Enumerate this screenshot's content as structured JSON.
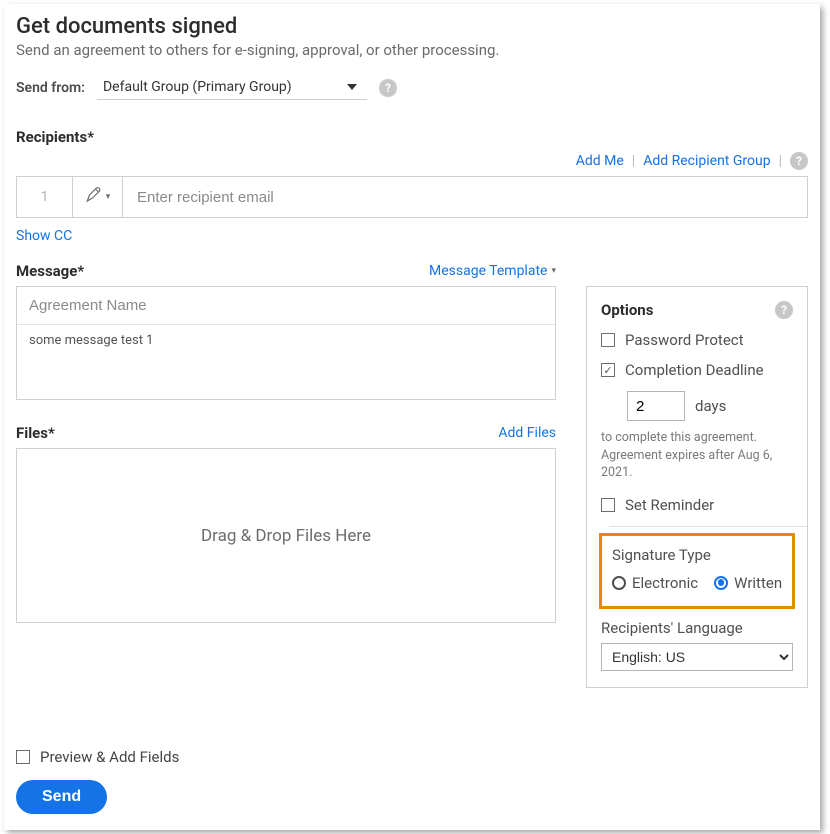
{
  "header": {
    "title": "Get documents signed",
    "subtitle": "Send an agreement to others for e-signing, approval, or other processing."
  },
  "send_from": {
    "label": "Send from:",
    "selected": "Default Group (Primary Group)"
  },
  "recipients": {
    "label": "Recipients*",
    "add_me": "Add Me",
    "add_group": "Add Recipient Group",
    "row_number": "1",
    "input_placeholder": "Enter recipient email",
    "show_cc": "Show CC"
  },
  "message": {
    "label": "Message*",
    "template_link": "Message Template",
    "name_placeholder": "Agreement Name",
    "body_value": "some message test 1"
  },
  "files": {
    "label": "Files*",
    "add_files": "Add Files",
    "dropzone": "Drag & Drop Files Here"
  },
  "options": {
    "title": "Options",
    "password_protect": "Password Protect",
    "completion_deadline": "Completion Deadline",
    "days_value": "2",
    "days_label": "days",
    "hint_line1": "to complete this agreement.",
    "hint_line2": "Agreement expires after Aug 6, 2021.",
    "set_reminder": "Set Reminder",
    "signature_type_label": "Signature Type",
    "electronic": "Electronic",
    "written": "Written",
    "recipients_language_label": "Recipients' Language",
    "language_selected": "English: US"
  },
  "footer": {
    "preview": "Preview & Add Fields",
    "send": "Send"
  }
}
